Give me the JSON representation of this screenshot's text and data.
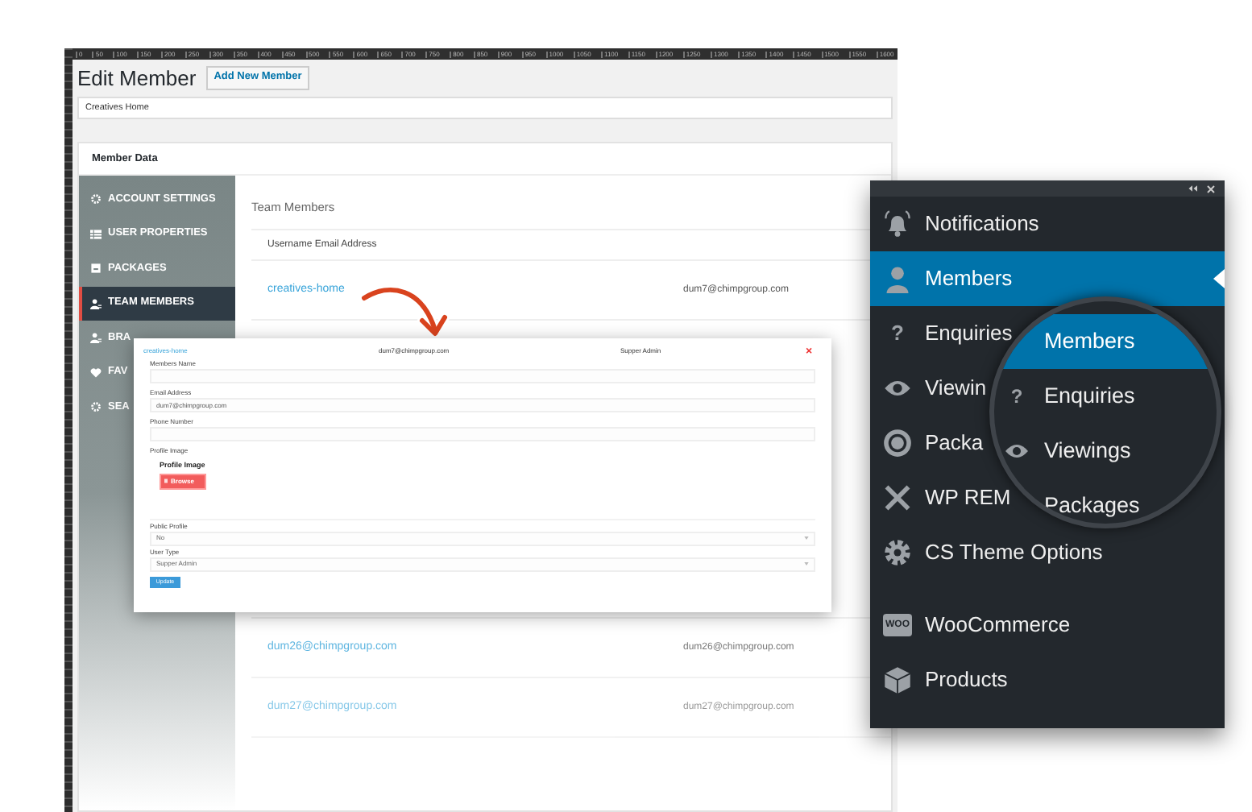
{
  "ruler": {
    "labels": [
      "0",
      "50",
      "100",
      "150",
      "200",
      "250",
      "300",
      "350",
      "400",
      "450",
      "500",
      "550",
      "600",
      "650",
      "700",
      "750",
      "800",
      "850",
      "900",
      "950",
      "1000",
      "1050",
      "1100",
      "1150",
      "1200",
      "1250",
      "1300",
      "1350",
      "1400",
      "1450",
      "1500",
      "1550",
      "1600"
    ]
  },
  "page": {
    "title": "Edit Member",
    "add_button": "Add New Member",
    "title_field": {
      "value": "Creatives Home"
    }
  },
  "member_data": {
    "heading": "Member Data",
    "tabs": [
      {
        "label": "ACCOUNT SETTINGS",
        "selected": false
      },
      {
        "label": "USER PROPERTIES",
        "selected": false
      },
      {
        "label": "PACKAGES",
        "selected": false
      },
      {
        "label": "TEAM MEMBERS",
        "selected": true
      },
      {
        "label": "BRA",
        "selected": false
      },
      {
        "label": "FAV",
        "selected": false
      },
      {
        "label": "SEA",
        "selected": false
      }
    ],
    "section_title": "Team Members",
    "table": {
      "header": "Username Email Address",
      "rows": [
        {
          "username": "creatives-home",
          "email": "dum7@chimpgroup.com"
        },
        {
          "username": "dum26@chimpgroup.com",
          "email": "dum26@chimpgroup.com"
        },
        {
          "username": "dum27@chimpgroup.com",
          "email": "dum27@chimpgroup.com"
        }
      ]
    }
  },
  "modal": {
    "username": "creatives-home",
    "email": "dum7@chimpgroup.com",
    "role": "Supper Admin",
    "close": "×",
    "fields": [
      {
        "kind": "text",
        "label": "Members Name"
      },
      {
        "kind": "text",
        "label": "Email Address",
        "value": "dum7@chimpgroup.com"
      },
      {
        "kind": "text",
        "label": "Phone Number"
      },
      {
        "kind": "image",
        "label": "Profile Image",
        "title": "Profile Image",
        "button": "Browse"
      },
      {
        "kind": "select",
        "label": "Public Profile",
        "value": "No"
      },
      {
        "kind": "select",
        "label": "User Type",
        "value": "Supper Admin"
      }
    ],
    "submit": "Update"
  },
  "admin_menu": {
    "items": [
      {
        "label": "Notifications",
        "selected": false,
        "separated": false
      },
      {
        "label": "Members",
        "selected": true,
        "separated": false
      },
      {
        "label": "Enquiries",
        "icon_text": "?",
        "selected": false,
        "separated": false
      },
      {
        "label": "Viewin",
        "selected": false,
        "separated": false
      },
      {
        "label": "Packa",
        "selected": false,
        "separated": false
      },
      {
        "label": "WP REM",
        "selected": false,
        "separated": false
      },
      {
        "label": "CS Theme Options",
        "selected": false,
        "separated": false
      },
      {
        "label": "WooCommerce",
        "logo_text": "WOO",
        "selected": false,
        "separated": true
      },
      {
        "label": "Products",
        "selected": false,
        "separated": false
      }
    ]
  },
  "magnifier": {
    "items": [
      {
        "label": "Members",
        "selected": true
      },
      {
        "label": "Enquiries",
        "icon_text": "?",
        "selected": false
      },
      {
        "label": "Viewings",
        "selected": false
      },
      {
        "label": "Packages",
        "selected": false
      }
    ]
  }
}
